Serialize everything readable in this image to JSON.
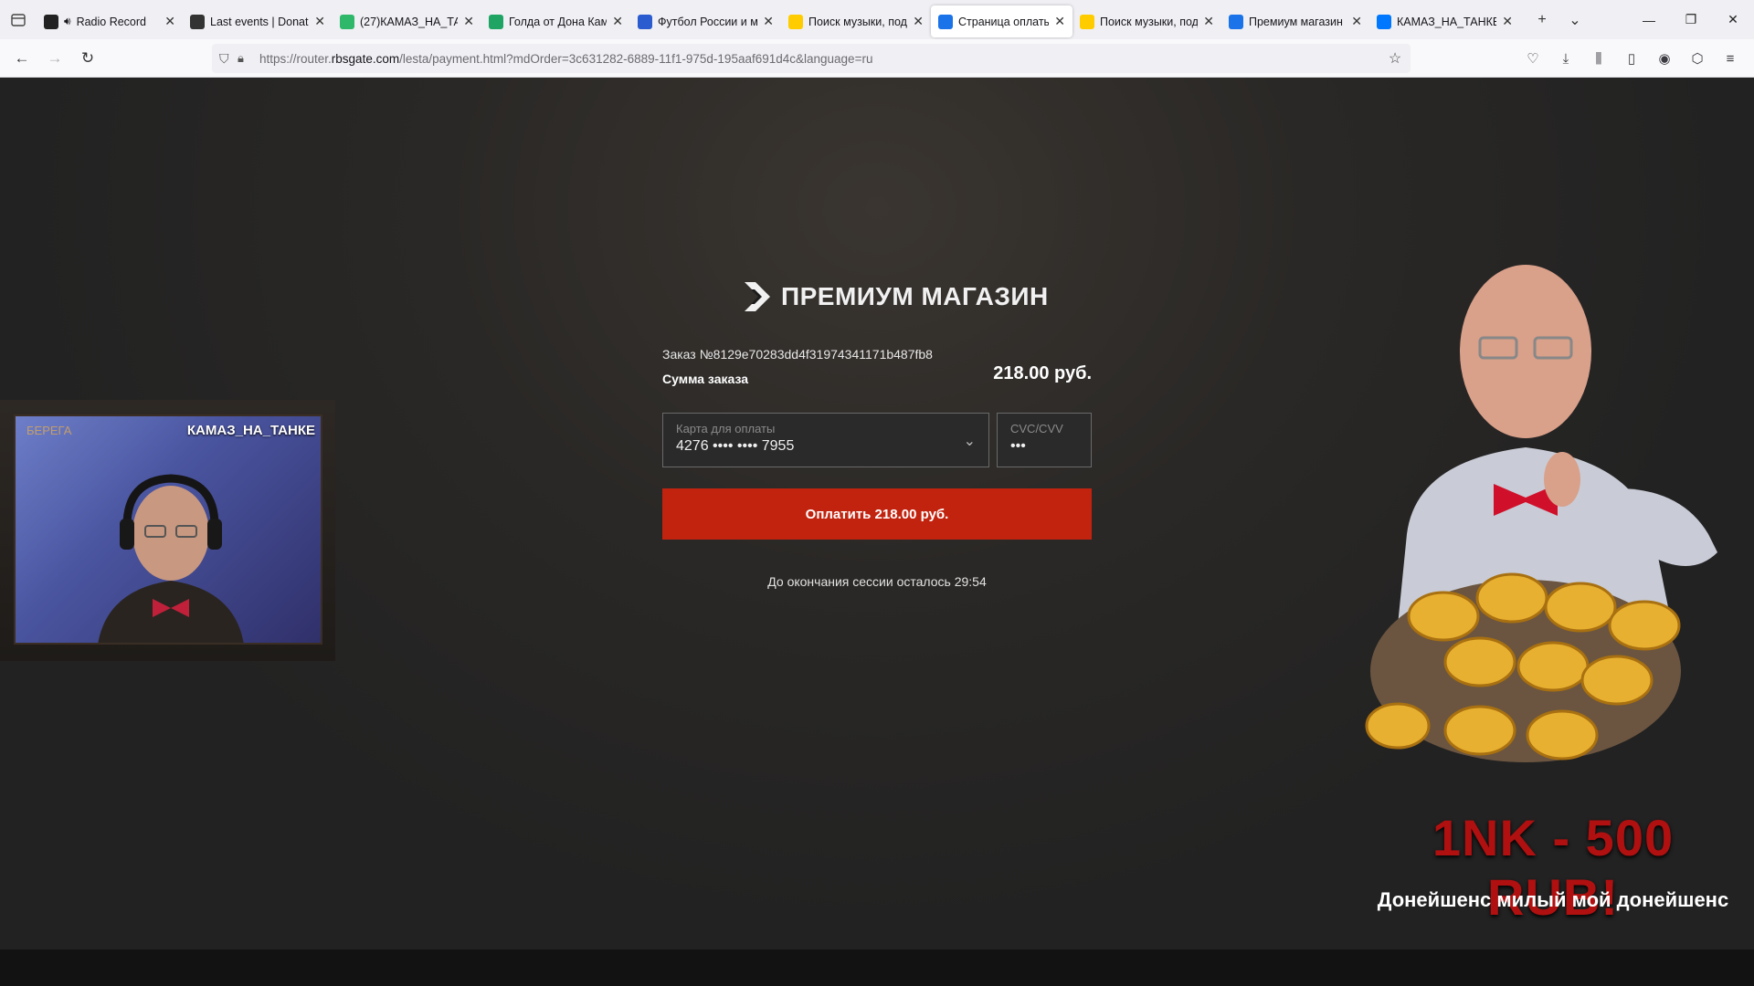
{
  "browser": {
    "tabs": [
      {
        "label": "Radio Record",
        "icon": "radio-record-icon",
        "color": "#222222",
        "audio": true
      },
      {
        "label": "Last events | Donat",
        "icon": "donationalerts-icon",
        "color": "#333333"
      },
      {
        "label": "(27)КАМАЗ_НА_ТА",
        "icon": "vkplay-icon",
        "color": "#2fb86a"
      },
      {
        "label": "Голда от Дона Кам",
        "icon": "sheets-icon",
        "color": "#1fa463"
      },
      {
        "label": "Футбол России и м",
        "icon": "sports-icon",
        "color": "#2b5ccf"
      },
      {
        "label": "Поиск музыки, под",
        "icon": "yandex-music-icon",
        "color": "#ffcc00"
      },
      {
        "label": "Страница оплаты",
        "icon": "lesta-icon",
        "color": "#1a73e8",
        "active": true
      },
      {
        "label": "Поиск музыки, под",
        "icon": "yandex-music-icon",
        "color": "#ffcc00"
      },
      {
        "label": "Премиум магазин",
        "icon": "lesta-icon",
        "color": "#1a73e8"
      },
      {
        "label": "КАМАЗ_НА_ТАНКЕ",
        "icon": "vk-icon",
        "color": "#0077ff"
      }
    ],
    "url_prefix": "https://router.",
    "url_host": "rbsgate.com",
    "url_rest": "/lesta/payment.html?mdOrder=3c631282-6889-11f1-975d-195aaf691d4c&language=ru"
  },
  "store": {
    "title": "ПРЕМИУМ МАГАЗИН",
    "order_number": "Заказ №8129e70283dd4f31974341171b487fb8",
    "sum_label": "Сумма заказа",
    "sum_value": "218.00 руб.",
    "card_label": "Карта для оплаты",
    "card_value": "4276 •••• •••• 7955",
    "cvc_label": "CVC/CVV",
    "cvc_value": "•••",
    "pay_button": "Оплатить 218.00 руб.",
    "session_text": "До окончания сессии осталось 29:54"
  },
  "stream": {
    "webcam_name": "КАМАЗ_НА_ТАНКЕ",
    "webcam_tag": "БЕРЕГА",
    "promo_title": "1NK - 500 RUB!",
    "promo_sub": "Донейшенс милый мой донейшенс"
  },
  "colors": {
    "pay_button": "#c2230f",
    "promo_title": "#b01010",
    "background": "#222222"
  }
}
